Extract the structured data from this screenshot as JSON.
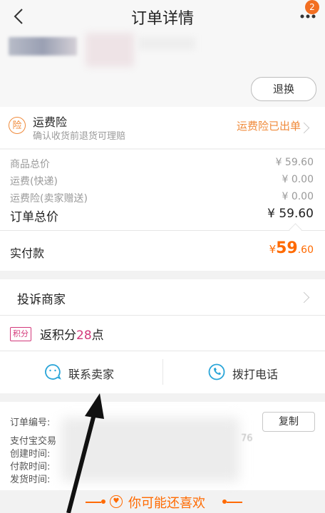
{
  "header": {
    "title": "订单详情",
    "badge_count": "2",
    "return_button": "退换"
  },
  "insurance": {
    "icon_text": "险",
    "title": "运费险",
    "subtitle": "确认收货前退货可理赔",
    "status": "运费险已出单"
  },
  "prices": {
    "rows": [
      {
        "label": "商品总价",
        "value": "¥ 59.60"
      },
      {
        "label": "运费(快递)",
        "value": "¥ 0.00"
      },
      {
        "label": "运费险(卖家赠送)",
        "value": "¥ 0.00"
      }
    ],
    "total_label": "订单总价",
    "total_value": "¥ 59.60",
    "paid_label": "实付款",
    "paid_currency": "¥",
    "paid_int": "59",
    "paid_dec": ".60"
  },
  "actions": {
    "complain": "投诉商家",
    "points_tag": "积分",
    "points_prefix": "返积分",
    "points_num": "28",
    "points_suffix": "点",
    "contact_seller": "联系卖家",
    "call_phone": "拨打电话"
  },
  "order_info": {
    "labels": [
      "订单编号:",
      "支付宝交易",
      "创建时间:",
      "付款时间:",
      "发货时间:"
    ],
    "copy_button": "复制",
    "partial_tail": "76"
  },
  "recommend": {
    "title": "你可能还喜欢"
  },
  "colors": {
    "accent": "#ff6a00",
    "points": "#d3387a",
    "badge": "#f26f22"
  }
}
